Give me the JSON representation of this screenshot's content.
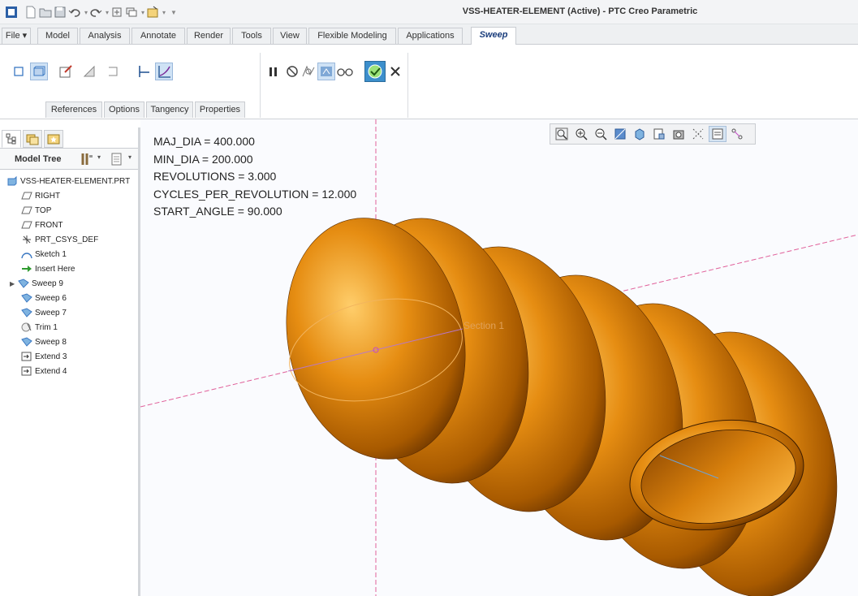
{
  "window": {
    "title": "VSS-HEATER-ELEMENT (Active) - PTC Creo Parametric"
  },
  "quick_access": {
    "icons": [
      "app-icon",
      "new-icon",
      "open-icon",
      "save-icon",
      "undo-icon",
      "redo-icon",
      "regenerate-icon",
      "windows-icon",
      "close-window-icon",
      "customize-icon"
    ]
  },
  "tabs": [
    {
      "label": "File ▾"
    },
    {
      "label": "Model"
    },
    {
      "label": "Analysis"
    },
    {
      "label": "Annotate"
    },
    {
      "label": "Render"
    },
    {
      "label": "Tools"
    },
    {
      "label": "View"
    },
    {
      "label": "Flexible Modeling"
    },
    {
      "label": "Applications"
    },
    {
      "label": "Sweep"
    }
  ],
  "ribbon": {
    "tools": [
      "solid-icon",
      "surface-icon",
      "sketch-icon",
      "remove-material-icon",
      "thicken-icon",
      "constant-section-icon",
      "variable-section-icon"
    ],
    "controls": [
      "pause-icon",
      "no-preview-icon",
      "verify-icon",
      "attached-preview-icon",
      "glasses-icon",
      "ok-icon",
      "cancel-icon"
    ],
    "subtabs": [
      {
        "label": "References"
      },
      {
        "label": "Options"
      },
      {
        "label": "Tangency"
      },
      {
        "label": "Properties"
      }
    ]
  },
  "model_tree": {
    "header": "Model Tree",
    "items": [
      {
        "label": "VSS-HEATER-ELEMENT.PRT",
        "icon": "part-icon"
      },
      {
        "label": "RIGHT",
        "icon": "datum-plane-icon"
      },
      {
        "label": "TOP",
        "icon": "datum-plane-icon"
      },
      {
        "label": "FRONT",
        "icon": "datum-plane-icon"
      },
      {
        "label": "PRT_CSYS_DEF",
        "icon": "csys-icon"
      },
      {
        "label": "Sketch 1",
        "icon": "sketch-icon"
      },
      {
        "label": "Insert Here",
        "icon": "insert-arrow-icon"
      },
      {
        "label": "Sweep 9",
        "icon": "sweep-icon"
      },
      {
        "label": "Sweep 6",
        "icon": "sweep-icon"
      },
      {
        "label": "Sweep 7",
        "icon": "sweep-icon"
      },
      {
        "label": "Trim 1",
        "icon": "trim-icon"
      },
      {
        "label": "Sweep 8",
        "icon": "sweep-icon"
      },
      {
        "label": "Extend 3",
        "icon": "extend-icon"
      },
      {
        "label": "Extend 4",
        "icon": "extend-icon"
      }
    ]
  },
  "view_toolbar": {
    "icons": [
      "refit-icon",
      "zoom-in-icon",
      "zoom-out-icon",
      "repaint-icon",
      "display-style-icon",
      "saved-orientations-icon",
      "view-manager-icon",
      "datum-display-icon",
      "annotation-display-icon",
      "spin-center-icon"
    ]
  },
  "parameters": [
    "MAJ_DIA = 400.000",
    "MIN_DIA =  200.000",
    "REVOLUTIONS = 3.000",
    "CYCLES_PER_REVOLUTION = 12.000",
    "START_ANGLE = 90.000"
  ],
  "graphics": {
    "section_label": "Section 1",
    "colors": {
      "surface": "#e08a10",
      "surface_dark": "#7a3f00",
      "datum": "#e0609a",
      "background": "#fafbfe"
    }
  }
}
